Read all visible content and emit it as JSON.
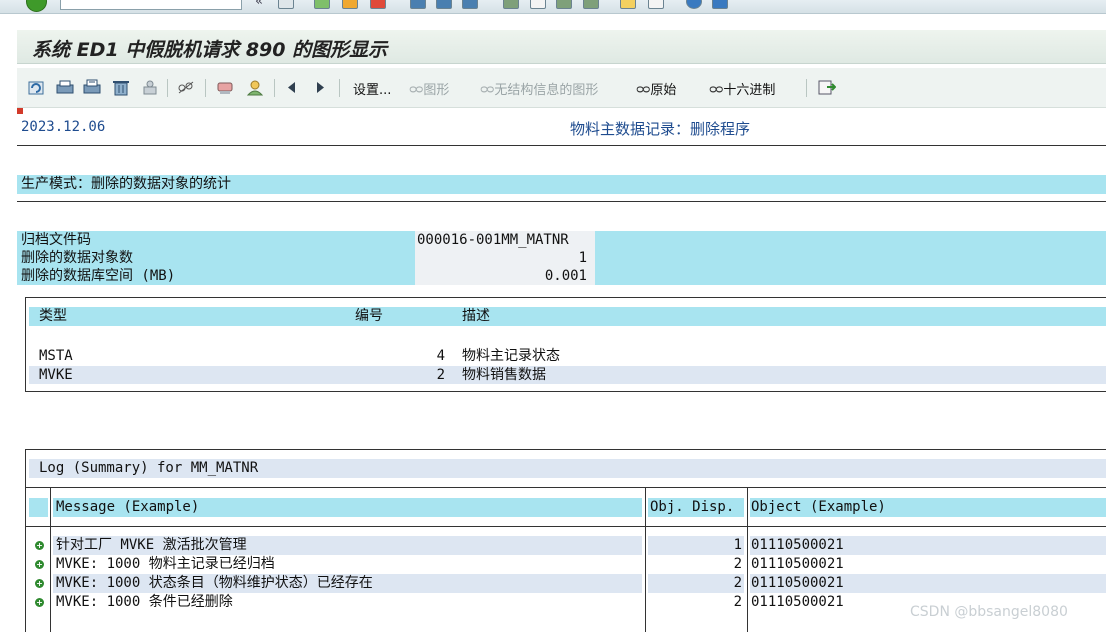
{
  "window": {
    "title": "系统 ED1 中假脱机请求 890 的图形显示"
  },
  "toolbar": {
    "settings_label": "设置...",
    "graphic_label": "图形",
    "unstructured_graphic_label": "无结构信息的图形",
    "raw_label": "原始",
    "hex_label": "十六进制"
  },
  "report": {
    "date": "2023.12.06",
    "heading": "物料主数据记录：删除程序",
    "section_title": "生产模式：删除的数据对象的统计",
    "summary": [
      {
        "label": "归档文件码",
        "value": "000016-001MM_MATNR"
      },
      {
        "label": "删除的数据对象数",
        "value": "1"
      },
      {
        "label": "删除的数据库空间 (MB)",
        "value": "0.001"
      }
    ],
    "type_table": {
      "headers": {
        "type": "类型",
        "number": "编号",
        "desc": "描述"
      },
      "rows": [
        {
          "type": "MSTA",
          "number": "4",
          "desc": "物料主记录状态"
        },
        {
          "type": "MVKE",
          "number": "2",
          "desc": "物料销售数据"
        }
      ]
    },
    "log": {
      "title": "Log (Summary) for MM_MATNR",
      "headers": {
        "message": "Message (Example)",
        "disp": "Obj. Disp.",
        "object": "Object (Example)"
      },
      "rows": [
        {
          "message": "针对工厂 MVKE 激活批次管理",
          "disp": "1",
          "object": "01110500021"
        },
        {
          "message": "MVKE: 1000 物料主记录已经归档",
          "disp": "2",
          "object": "01110500021"
        },
        {
          "message": "MVKE: 1000 状态条目（物料维护状态）已经存在",
          "disp": "2",
          "object": "01110500021"
        },
        {
          "message": "MVKE: 1000 条件已经删除",
          "disp": "2",
          "object": "01110500021"
        }
      ]
    }
  },
  "watermark": "CSDN @bbsangel8080"
}
